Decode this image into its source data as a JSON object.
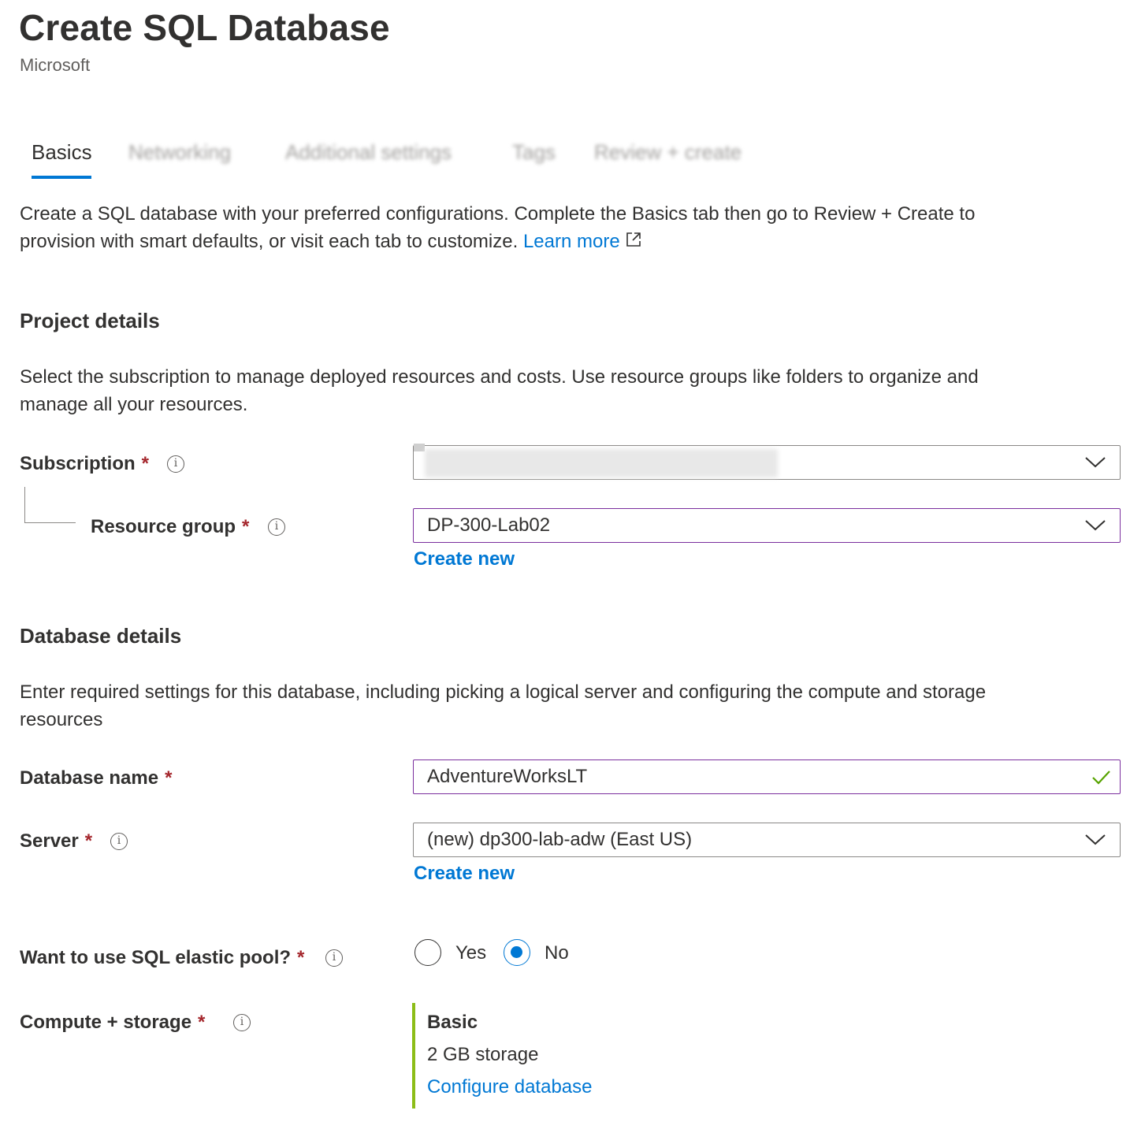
{
  "header": {
    "title": "Create SQL Database",
    "publisher": "Microsoft"
  },
  "tabs": [
    {
      "label": "Basics",
      "active": true
    },
    {
      "label": "Networking",
      "active": false
    },
    {
      "label": "Additional settings",
      "active": false
    },
    {
      "label": "Tags",
      "active": false
    },
    {
      "label": "Review + create",
      "active": false
    }
  ],
  "intro": {
    "line1": "Create a SQL database with your preferred configurations. Complete the Basics tab then go to Review + Create to",
    "line2": "provision with smart defaults, or visit each tab to customize.",
    "learn_more": "Learn more"
  },
  "project": {
    "title": "Project details",
    "desc_line1": "Select the subscription to manage deployed resources and costs. Use resource groups like folders to organize and",
    "desc_line2": "manage all your resources.",
    "subscription_label": "Subscription",
    "resource_group_label": "Resource group",
    "resource_group_value": "DP-300-Lab02",
    "create_new": "Create new"
  },
  "database": {
    "title": "Database details",
    "desc_line1": "Enter required settings for this database, including picking a logical server and configuring the compute and storage",
    "desc_line2": "resources",
    "name_label": "Database name",
    "name_value": "AdventureWorksLT",
    "server_label": "Server",
    "server_value": "(new) dp300-lab-adw (East US)",
    "create_new": "Create new",
    "elastic_label": "Want to use SQL elastic pool?",
    "elastic_options": [
      "Yes",
      "No"
    ],
    "elastic_selected": "No",
    "compute_label": "Compute + storage",
    "tier_name": "Basic",
    "tier_storage": "2 GB storage",
    "configure_link": "Configure database"
  },
  "required_mark": "*",
  "icons": {
    "info": "info-icon",
    "chevron": "chevron-down-icon",
    "external": "external-link-icon",
    "valid": "checkmark-icon"
  },
  "colors": {
    "accent": "#0078d4",
    "required": "#a4262c",
    "focus_border": "#7a2e9e",
    "valid": "#57a300",
    "tier_bar": "#8cbd18"
  }
}
